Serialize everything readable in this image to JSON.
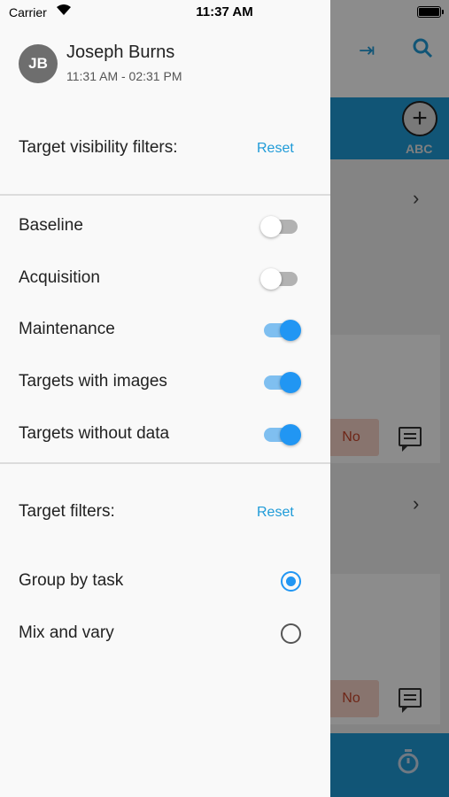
{
  "status_bar": {
    "carrier": "Carrier",
    "time": "11:37 AM"
  },
  "user": {
    "initials": "JB",
    "name": "Joseph Burns",
    "time_range": "11:31 AM - 02:31 PM"
  },
  "visibility_filters": {
    "title": "Target visibility filters:",
    "reset_label": "Reset",
    "items": [
      {
        "label": "Baseline",
        "enabled": false
      },
      {
        "label": "Acquisition",
        "enabled": false
      },
      {
        "label": "Maintenance",
        "enabled": true
      },
      {
        "label": "Targets with images",
        "enabled": true
      },
      {
        "label": "Targets without data",
        "enabled": true
      }
    ]
  },
  "target_filters": {
    "title": "Target filters:",
    "reset_label": "Reset",
    "options": [
      {
        "label": "Group by task",
        "selected": true
      },
      {
        "label": "Mix and vary",
        "selected": false
      }
    ]
  },
  "background": {
    "header_button": "ABC",
    "no_label_1": "No",
    "no_label_2": "No"
  },
  "colors": {
    "accent": "#2196f3",
    "link": "#1f9bd8",
    "band": "#1f9bd8"
  }
}
